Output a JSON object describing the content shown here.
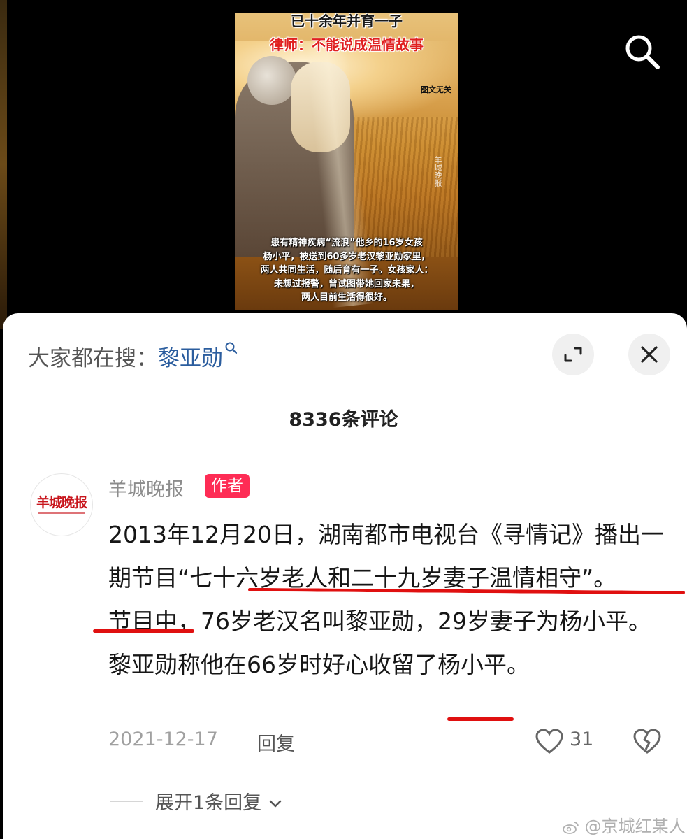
{
  "video": {
    "title_line1": "已十余年并育一子",
    "title_line2": "律师：不能说成温情故事",
    "disclaimer": "图文无关",
    "watermark": "羊城晚报",
    "caption_lines": [
      "患有精神疾病“流浪”他乡的16岁女孩",
      "杨小平，被送到60多岁老汉黎亚勋家里，",
      "两人共同生活，随后育有一子。女孩家人：",
      "未想过报警，曾试图带她回家未果，",
      "两人目前生活得很好。"
    ]
  },
  "hot_search": {
    "prefix": "大家都在搜：",
    "term": "黎亚勋"
  },
  "comments_count_label": "8336条评论",
  "comment": {
    "avatar_text": "羊城晚报",
    "username": "羊城晚报",
    "author_tag": "作者",
    "paragraph1": "2013年12月20日，湖南都市电视台《寻情记》播出一期节目“七十六岁老人和二十九岁妻子温情相守”。",
    "paragraph2": "节目中，76岁老汉名叫黎亚勋，29岁妻子为杨小平。黎亚勋称他在66岁时好心收留了杨小平。",
    "date": "2021-12-17",
    "reply_label": "回复",
    "like_count": "31",
    "expand_label": "展开1条回复"
  },
  "site_watermark": "@京城红某人",
  "colors": {
    "accent_red": "#fe2c55",
    "link_blue": "#2b5d9e",
    "underline_red": "#e01010"
  },
  "icons": [
    "search-icon",
    "expand-icon",
    "close-icon",
    "heart-icon",
    "broken-heart-icon",
    "chevron-down-icon",
    "weibo-icon"
  ]
}
